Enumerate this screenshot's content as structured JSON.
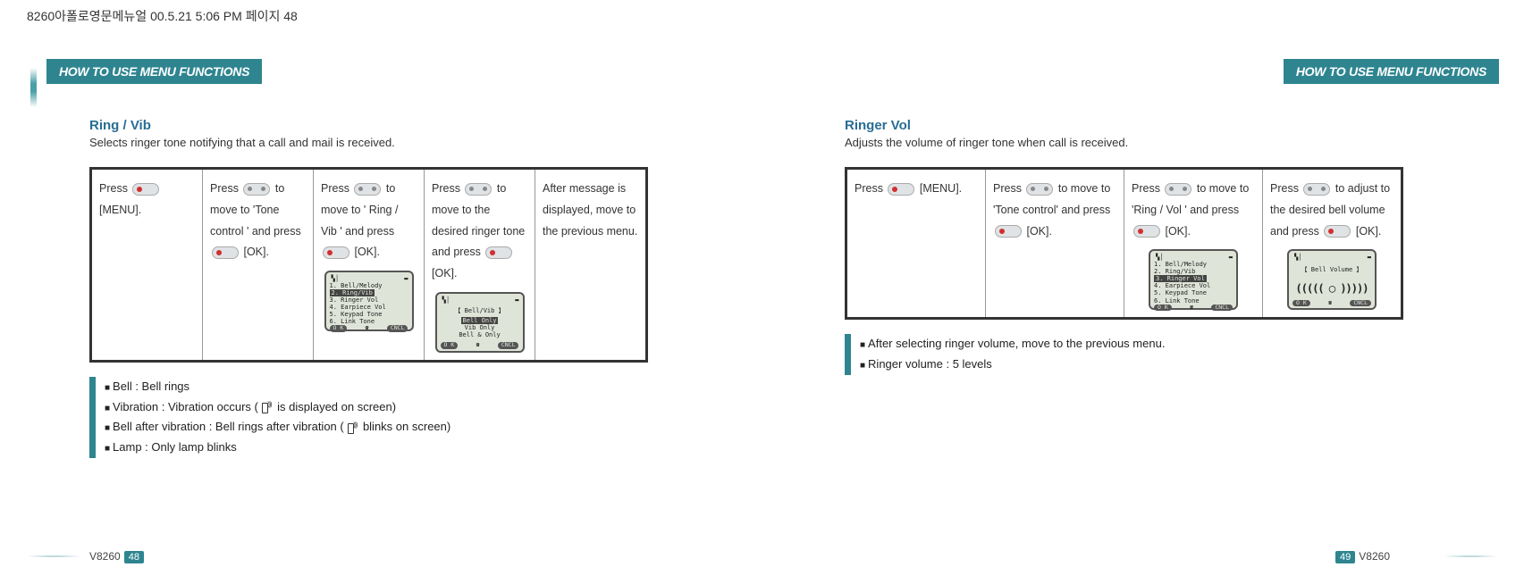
{
  "header_file_info": "8260아폴로영문메뉴얼   00.5.21 5:06 PM  페이지 48",
  "tab_title": "HOW TO USE MENU FUNCTIONS",
  "left": {
    "title": "Ring / Vib",
    "desc": "Selects ringer tone notifying that a call and mail is received.",
    "steps": [
      {
        "pre": "Press ",
        "key": "red",
        "post": " [MENU]."
      },
      {
        "pre": "Press ",
        "key": "split",
        "mid": " to move to  'Tone control ' and press ",
        "key2": "red",
        "post": " [OK]."
      },
      {
        "pre": "Press ",
        "key": "split",
        "mid": " to move to ' Ring / Vib ' and press ",
        "key2": "red",
        "post": " [OK].",
        "lcd": "menu"
      },
      {
        "pre": "Press ",
        "key": "split",
        "mid": " to move to the desired ringer tone and press ",
        "key2": "red",
        "post": " [OK].",
        "lcd": "bellvib"
      },
      {
        "text": "After message is displayed, move to the previous menu."
      }
    ],
    "lcd_menu": {
      "title": "",
      "lines": [
        "1. Bell/Melody",
        "2. Ring/Vib",
        "3. Ringer Vol",
        "4. Earpiece Vol",
        "5. Keypad Tone",
        "6. Link Tone"
      ],
      "hl_index": 1,
      "left_soft": "O K",
      "right_soft": "CNCL"
    },
    "lcd_bellvib": {
      "title": "【 Bell/Vib 】",
      "lines": [
        "Bell Only",
        "Vib Only",
        "Bell & Only"
      ],
      "hl_index": 0,
      "left_soft": "O K",
      "right_soft": "CNCL"
    },
    "notes": [
      "Bell : Bell rings",
      "Vibration : Vibration occurs (  is displayed on screen)",
      "Bell after vibration : Bell rings after vibration (   blinks on screen)",
      "Lamp : Only lamp blinks"
    ],
    "model": "V8260",
    "page": "48"
  },
  "right": {
    "title": "Ringer Vol",
    "desc": "Adjusts the volume of ringer tone when call is received.",
    "steps": [
      {
        "pre": "Press ",
        "key": "red",
        "post": " [MENU]."
      },
      {
        "pre": "Press ",
        "key": "split",
        "mid": " to move to  'Tone control'  and press ",
        "key2": "red",
        "post": " [OK]."
      },
      {
        "pre": "Press ",
        "key": "split",
        "mid": " to move to 'Ring / Vol ' and press ",
        "key2": "red",
        "post": " [OK].",
        "lcd": "menu2"
      },
      {
        "pre": "Press ",
        "key": "split",
        "mid": " to adjust to the desired bell volume and press ",
        "key2": "red",
        "post": " [OK].",
        "lcd": "vol"
      }
    ],
    "lcd_menu2": {
      "lines": [
        "1. Bell/Melody",
        "2. Ring/Vib",
        "3. Ringer Vol",
        "4. Earpiece Vol",
        "5. Keypad Tone",
        "6. Link Tone"
      ],
      "hl_index": 2,
      "left_soft": "O K",
      "right_soft": "CNCL"
    },
    "lcd_vol": {
      "title": "【 Bell Volume 】",
      "vol_display": "((((( ◯ )))))",
      "left_soft": "O K",
      "right_soft": "CNCL"
    },
    "notes": [
      "After selecting ringer volume, move to the previous menu.",
      "Ringer volume : 5 levels"
    ],
    "model": "V8260",
    "page": "49"
  }
}
